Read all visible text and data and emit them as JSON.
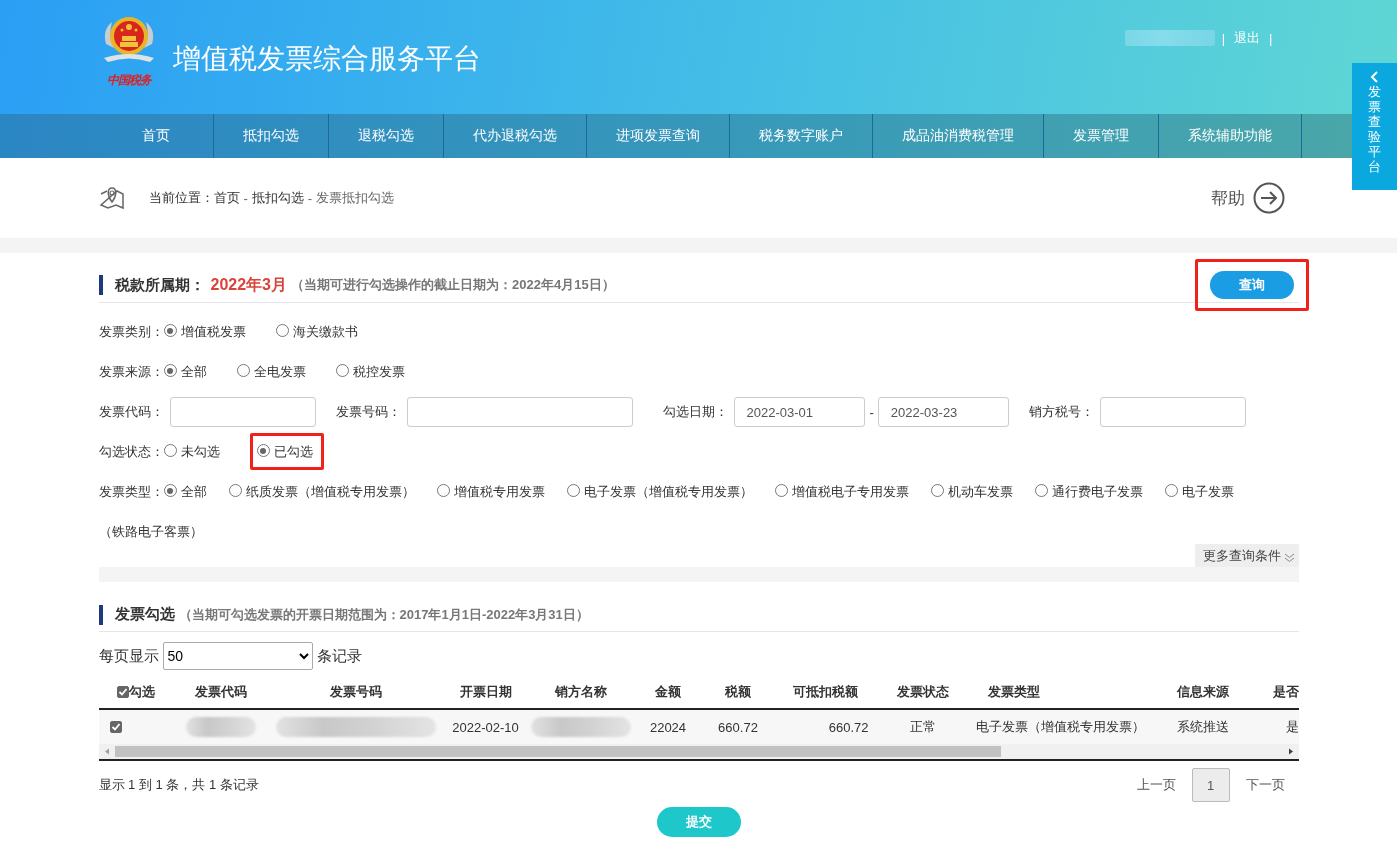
{
  "header": {
    "logo_text": "中国税务",
    "title": "增值税发票综合服务平台",
    "user": {
      "kind": "blurred"
    },
    "separator": "|",
    "logout": "退出"
  },
  "nav": [
    "首页",
    "抵扣勾选",
    "退税勾选",
    "代办退税勾选",
    "进项发票查询",
    "税务数字账户",
    "成品油消费税管理",
    "发票管理",
    "系统辅助功能"
  ],
  "side_tab": {
    "label": "发票查验平台"
  },
  "breadcrumb": {
    "label": "当前位置：",
    "separator": "-",
    "items": [
      "首页",
      "抵扣勾选",
      "发票抵扣勾选"
    ],
    "help": "帮助"
  },
  "query_section": {
    "title": "税款所属期：",
    "period": "2022年3月",
    "note": "（当期可进行勾选操作的截止日期为：2022年4月15日）",
    "query_button": {
      "label": "查询",
      "highlighted": true
    },
    "filters": [
      {
        "kind": "radio",
        "label": "发票类别：",
        "options": [
          {
            "label": "增值税发票",
            "selected": true
          },
          {
            "label": "海关缴款书",
            "selected": false
          }
        ]
      },
      {
        "kind": "radio",
        "label": "发票来源：",
        "options": [
          {
            "label": "全部",
            "selected": true
          },
          {
            "label": "全电发票",
            "selected": false
          },
          {
            "label": "税控发票",
            "selected": false
          }
        ]
      },
      {
        "kind": "fields",
        "fields": [
          {
            "label": "发票代码："
          },
          {
            "label": "发票号码："
          },
          {
            "label": "勾选日期：",
            "values": [
              "2022-03-01",
              "2022-03-23"
            ],
            "separator": "-"
          },
          {
            "label": "销方税号："
          }
        ]
      },
      {
        "kind": "radio",
        "label": "勾选状态：",
        "options": [
          {
            "label": "未勾选",
            "selected": false,
            "highlighted": false
          },
          {
            "label": "已勾选",
            "selected": true,
            "highlighted": true
          }
        ]
      },
      {
        "kind": "radio",
        "label": "发票类型：",
        "options": [
          {
            "label": "全部",
            "selected": true
          },
          {
            "label": "纸质发票（增值税专用发票）",
            "selected": false
          },
          {
            "label": "增值税专用发票",
            "selected": false
          },
          {
            "label": "电子发票（增值税专用发票）",
            "selected": false
          },
          {
            "label": "增值税电子专用发票",
            "selected": false
          },
          {
            "label": "机动车发票",
            "selected": false
          },
          {
            "label": "通行费电子发票",
            "selected": false
          },
          {
            "label": "电子发票",
            "label_continued": "（铁路电子客票）",
            "selected": false
          }
        ]
      }
    ],
    "more_conditions": "更多查询条件"
  },
  "invoice_section": {
    "title": "发票勾选",
    "note": "（当期可勾选发票的开票日期范围为：2017年1月1日-2022年3月31日）",
    "page_size": {
      "prefix": "每页显示",
      "value": "50",
      "suffix": "条记录"
    },
    "table": {
      "select_all": {
        "label": "勾选",
        "checked": true
      },
      "columns": [
        "发票代码",
        "发票号码",
        "开票日期",
        "销方名称",
        "金额",
        "税额",
        "可抵扣税额",
        "发票状态",
        "发票类型",
        "信息来源",
        "是否"
      ],
      "rows": [
        {
          "checked": true,
          "cells": [
            {
              "kind": "blurred"
            },
            {
              "kind": "blurred"
            },
            {
              "kind": "text",
              "text": "2022-02-10"
            },
            {
              "kind": "blurred"
            },
            {
              "kind": "text",
              "text": "22024"
            },
            {
              "kind": "text",
              "text": "660.72"
            },
            {
              "kind": "text",
              "text": "660.72"
            },
            {
              "kind": "text",
              "text": "正常"
            },
            {
              "kind": "text",
              "text": "电子发票（增值税专用发票）"
            },
            {
              "kind": "text",
              "text": "系统推送"
            },
            {
              "kind": "text",
              "text": "是"
            }
          ]
        }
      ]
    },
    "summary": "显示 1 到 1 条，共 1 条记录",
    "pagination": {
      "prev": "上一页",
      "pages": [
        {
          "label": "1",
          "selected": true
        }
      ],
      "next": "下一页"
    },
    "submit": "提交"
  }
}
